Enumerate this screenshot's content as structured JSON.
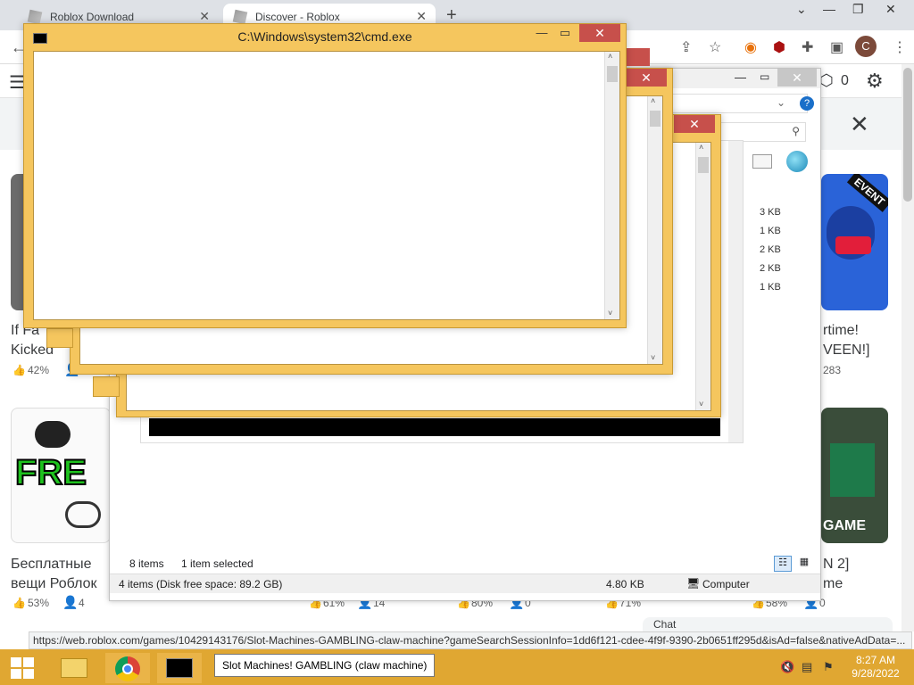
{
  "browser": {
    "tabs": [
      {
        "title": "Roblox Download"
      },
      {
        "title": "Discover - Roblox"
      }
    ],
    "profile_initial": "C"
  },
  "roblox": {
    "robux": "0",
    "games_row1": [
      {
        "title_l1": "If Fa",
        "title_l2": "Kicked",
        "rating": "42%"
      },
      {
        "title_l1": "rtime!",
        "title_l2": "VEEN!]",
        "players": "283"
      }
    ],
    "games_row2": [
      {
        "title_l1": "Бесплатные",
        "title_l2": "вещи Роблок",
        "rating": "53%",
        "players": "4"
      },
      {
        "title_l1": "N 2]",
        "title_l2": "me",
        "rating": "58%",
        "players": "0"
      }
    ],
    "mid_stats": [
      {
        "rating": "61%",
        "players": "14"
      },
      {
        "rating": "80%",
        "players": "0"
      },
      {
        "rating": "71%",
        "players": "0"
      }
    ],
    "thumb_text_event": "EVENT",
    "thumb_text_free": "FRE",
    "thumb_text_game": "GAME",
    "chat_label": "Chat"
  },
  "explorer": {
    "sizes": [
      "3 KB",
      "1 KB",
      "2 KB",
      "2 KB",
      "1 KB"
    ],
    "items_count": "8 items",
    "selected": "1 item selected",
    "status_left": "4 items (Disk free space: 89.2 GB)",
    "status_size": "4.80 KB",
    "status_location": "Computer"
  },
  "cmd": {
    "title": "C:\\Windows\\system32\\cmd.exe"
  },
  "status_url": "https://web.roblox.com/games/10429143176/Slot-Machines-GAMBLING-claw-machine?gameSearchSessionInfo=1dd6f121-cdee-4f9f-9390-2b0651ff295d&isAd=false&nativeAdData=...",
  "taskbar": {
    "tooltip": "Slot Machines! GAMBLING (claw machine)",
    "time": "8:27 AM",
    "date": "9/28/2022"
  },
  "colors": {
    "cmd_frame": "#f5c65e",
    "taskbar": "#e0a732",
    "close_red": "#c7504b"
  }
}
